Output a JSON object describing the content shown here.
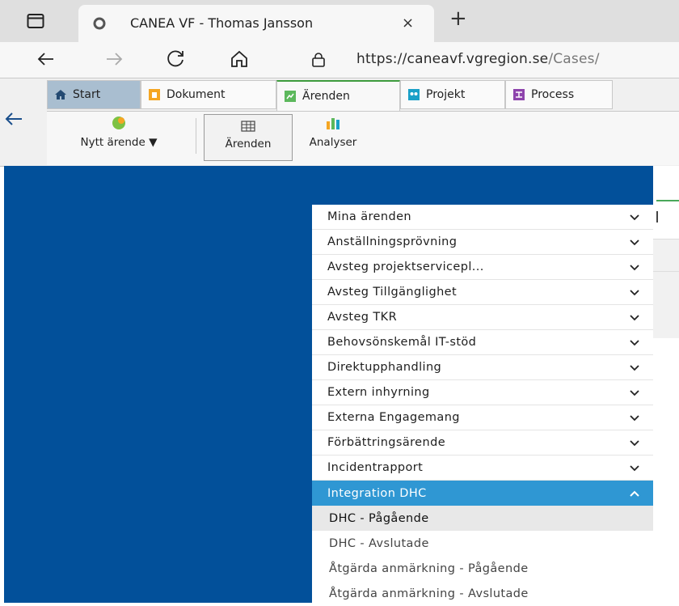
{
  "browser": {
    "tab_title": "CANEA VF - Thomas Jansson",
    "tab_close": "×",
    "new_tab": "+",
    "url_host": "https://caneavf.vgregion.se",
    "url_path": "/Cases/"
  },
  "ribbon": {
    "tabs": [
      {
        "label": "Start",
        "icon": "home-icon"
      },
      {
        "label": "Dokument",
        "icon": "document-icon"
      },
      {
        "label": "Ärenden",
        "icon": "cases-icon"
      },
      {
        "label": "Projekt",
        "icon": "project-icon"
      },
      {
        "label": "Process",
        "icon": "process-icon"
      }
    ],
    "tools": {
      "new_case": "Nytt ärende ▼",
      "cases": "Ärenden",
      "analyses": "Analyser"
    }
  },
  "menu": {
    "items": [
      "Mina ärenden",
      "Anställningsprövning",
      "Avsteg projektservicepl...",
      "Avsteg Tillgänglighet",
      "Avsteg TKR",
      "Behovsönskemål IT-stöd",
      "Direktupphandling",
      "Extern inhyrning",
      "Externa Engagemang",
      "Förbättringsärende",
      "Incidentrapport"
    ],
    "expanded": {
      "label": "Integration DHC",
      "children": [
        "DHC - Pågående",
        "DHC - Avslutade",
        "Åtgärda anmärkning - Pågående",
        "Åtgärda anmärkning - Avslutade"
      ]
    }
  },
  "colors": {
    "panel_blue": "#02509a",
    "active_blue": "#2f97d3",
    "start_tab": "#a9bed0"
  }
}
